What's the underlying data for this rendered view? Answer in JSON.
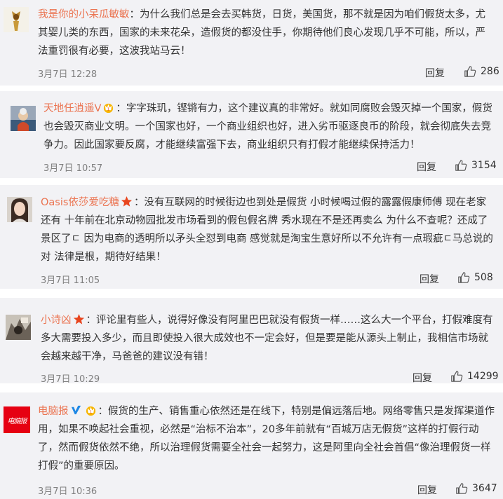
{
  "comments": [
    {
      "username": "我是你的小呆瓜敏敏",
      "text": "：为什么我们总是会去买韩货，日货，美国货，那不就是因为咱们假货太多，尤其婴儿类的东西，国家的未来花朵，造假货的都没住手，你期待他们良心发现几乎不可能，所以，严法重罚很有必要，这波我站马云！",
      "time": "3月7日 12:28",
      "reply_label": "回复",
      "likes": "286"
    },
    {
      "username": "天地任逍遥V",
      "text": "：字字珠玑，铿锵有力，这个建议真的非常好。就如同腐败会毁灭掉一个国家，假货也会毁灭商业文明。一个国家也好，一个商业组织也好，进入劣币驱逐良币的阶段，就会彻底失去竞争力。因此国家要反腐，才能继续富强下去，商业组织只有打假才能继续保持活力！",
      "time": "3月7日 10:57",
      "reply_label": "回复",
      "likes": "3154"
    },
    {
      "username": "Oasis依莎爱吃糖",
      "text": "：没有互联网的时候街边也到处是假货 小时候喝过假的露露假康师傅 现在老家还有 十年前在北京动物园批发市场看到的假包假名牌 秀水现在不是还再卖么 为什么不查呢？还成了景区了ㄷ 因为电商的透明所以矛头全怼到电商 感觉就是淘宝生意好所以不允许有一点瑕疵ㄷ马总说的对 法律是根，期待好结果！",
      "time": "3月7日 11:05",
      "reply_label": "回复",
      "likes": "508"
    },
    {
      "username": "小诗凶",
      "text": "：评论里有些人，说得好像没有阿里巴巴就没有假货一样……这么大一个平台，打假难度有多大需要投入多少，而且即使投入很大成效也不一定会好，但是要是能从源头上制止，我相信市场就会越来越干净，马爸爸的建议没有错！",
      "time": "3月7日 10:29",
      "reply_label": "回复",
      "likes": "14299"
    },
    {
      "username": "电脑报",
      "text": "：假货的生产、销售重心依然还是在线下，特别是偏远落后地。网络零售只是发挥渠道作用，如果不唤起社会重视，必然是“治标不治本”，20多年前就有“百城万店无假货”这样的打假行动了，然而假货依然不绝，所以治理假货需要全社会一起努力，这是阿里向全社会首倡“像治理假货一样打假”的重要原因。",
      "time": "3月7日 10:36",
      "reply_label": "回复",
      "likes": "3647"
    }
  ],
  "avatar_logo_text": "电脑报",
  "colors": {
    "username": "#eb7350",
    "card_bg": "#f2f2f5",
    "meta": "#808080",
    "star": "#e8451e",
    "verified": "#1e88e5"
  }
}
